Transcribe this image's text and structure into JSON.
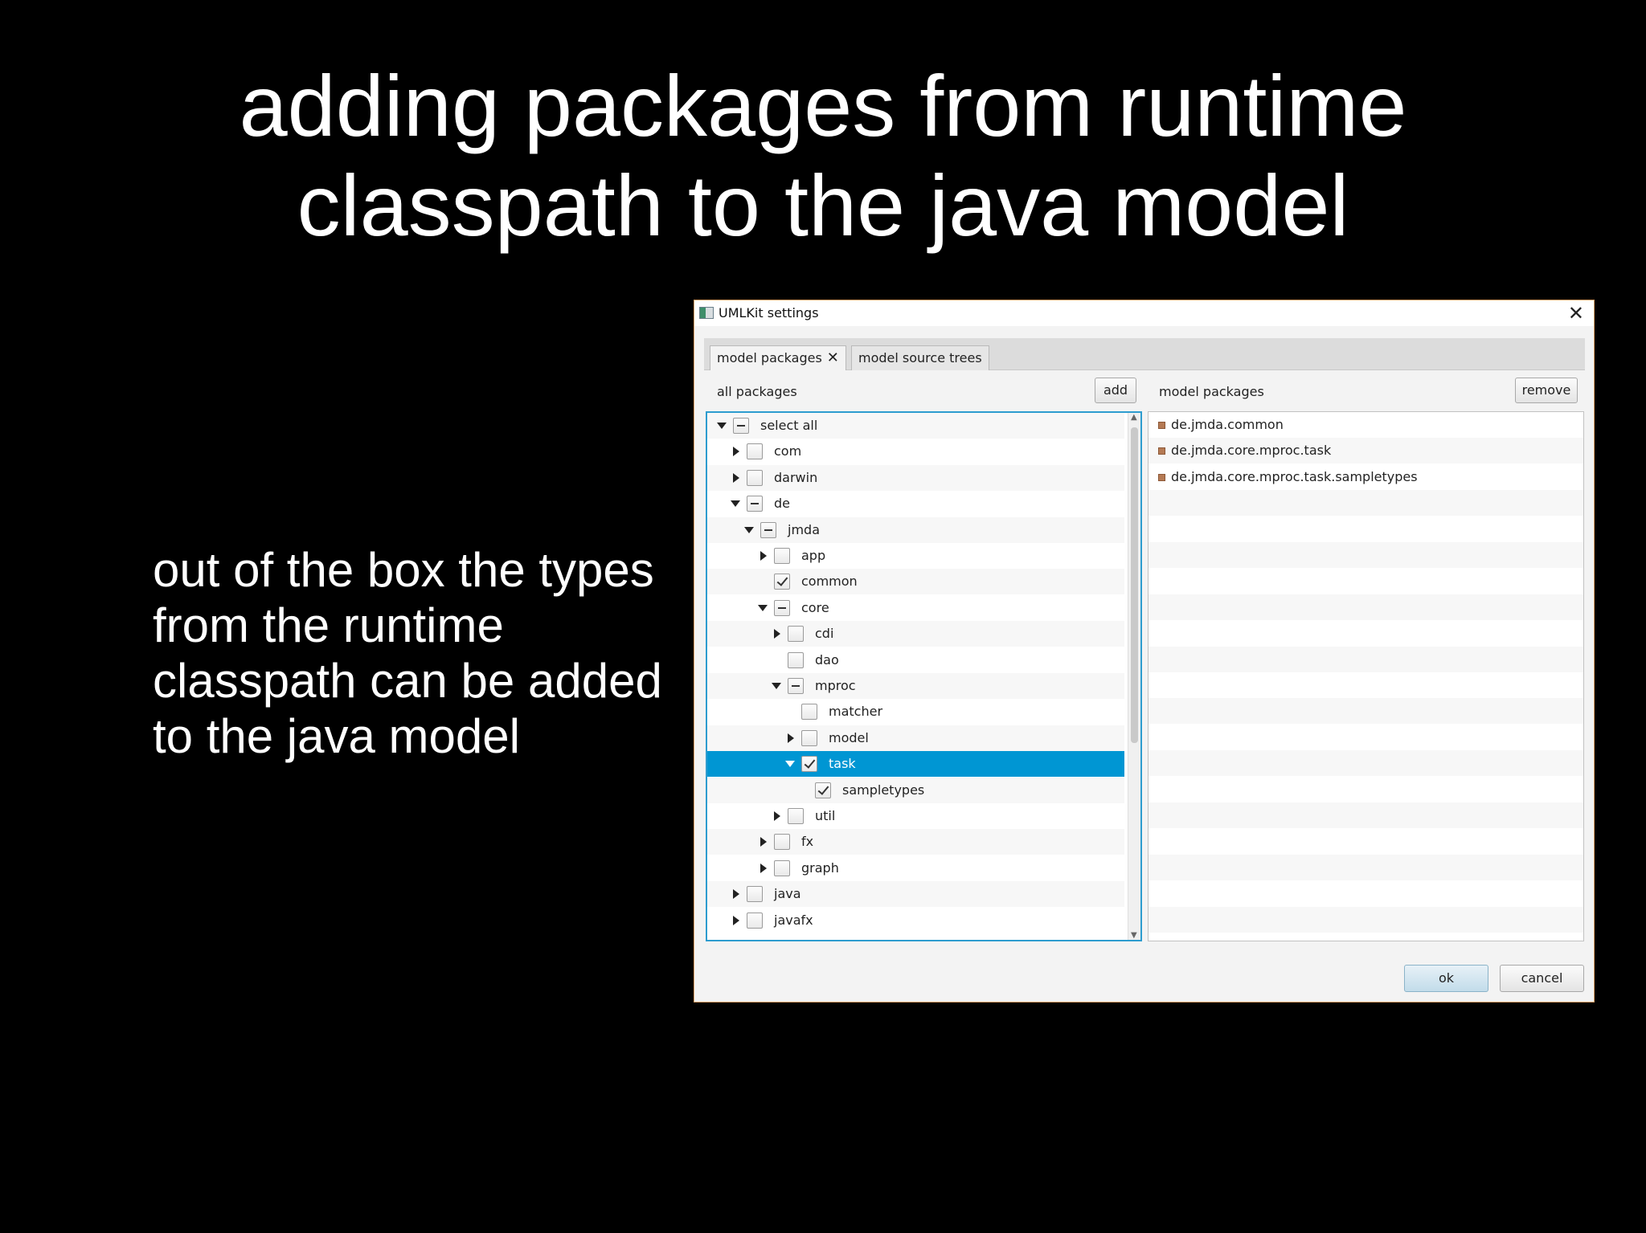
{
  "slide": {
    "title_lines": [
      "adding packages from runtime",
      "classpath to the java model"
    ],
    "side_lines": [
      "out of the box the types",
      "from the runtime",
      "classpath can be added",
      "to the java model"
    ]
  },
  "dialog": {
    "title": "UMLKit settings",
    "close_glyph": "✕",
    "tabs": [
      {
        "label": "model packages",
        "close_glyph": "✕"
      },
      {
        "label": "model source trees"
      }
    ],
    "left_pane": {
      "label": "all packages",
      "add_button": "add",
      "tree": [
        {
          "label": "select all",
          "level": 0,
          "arrow": "expanded",
          "check": "ind"
        },
        {
          "label": "com",
          "level": 1,
          "arrow": "collapsed",
          "check": "none"
        },
        {
          "label": "darwin",
          "level": 1,
          "arrow": "collapsed",
          "check": "none"
        },
        {
          "label": "de",
          "level": 1,
          "arrow": "expanded",
          "check": "ind"
        },
        {
          "label": "jmda",
          "level": 2,
          "arrow": "expanded",
          "check": "ind"
        },
        {
          "label": "app",
          "level": 3,
          "arrow": "collapsed",
          "check": "none"
        },
        {
          "label": "common",
          "level": 3,
          "arrow": "none",
          "check": "chk"
        },
        {
          "label": "core",
          "level": 3,
          "arrow": "expanded",
          "check": "ind"
        },
        {
          "label": "cdi",
          "level": 4,
          "arrow": "collapsed",
          "check": "none"
        },
        {
          "label": "dao",
          "level": 4,
          "arrow": "none",
          "check": "none"
        },
        {
          "label": "mproc",
          "level": 4,
          "arrow": "expanded",
          "check": "ind"
        },
        {
          "label": "matcher",
          "level": 5,
          "arrow": "none",
          "check": "none"
        },
        {
          "label": "model",
          "level": 5,
          "arrow": "collapsed",
          "check": "none"
        },
        {
          "label": "task",
          "level": 5,
          "arrow": "expanded",
          "check": "chk",
          "selected": true
        },
        {
          "label": "sampletypes",
          "level": 6,
          "arrow": "none",
          "check": "chk"
        },
        {
          "label": "util",
          "level": 4,
          "arrow": "collapsed",
          "check": "none"
        },
        {
          "label": "fx",
          "level": 3,
          "arrow": "collapsed",
          "check": "none"
        },
        {
          "label": "graph",
          "level": 3,
          "arrow": "collapsed",
          "check": "none"
        },
        {
          "label": "java",
          "level": 1,
          "arrow": "collapsed",
          "check": "none"
        },
        {
          "label": "javafx",
          "level": 1,
          "arrow": "collapsed",
          "check": "none"
        }
      ]
    },
    "right_pane": {
      "label": "model packages",
      "remove_button": "remove",
      "items": [
        "de.jmda.common",
        "de.jmda.core.mproc.task",
        "de.jmda.core.mproc.task.sampletypes"
      ],
      "total_rows": 20
    },
    "ok_button": "ok",
    "cancel_button": "cancel"
  },
  "colors": {
    "background": "#000000",
    "selection": "#0096d3",
    "focus_border": "#2d9ccf"
  }
}
